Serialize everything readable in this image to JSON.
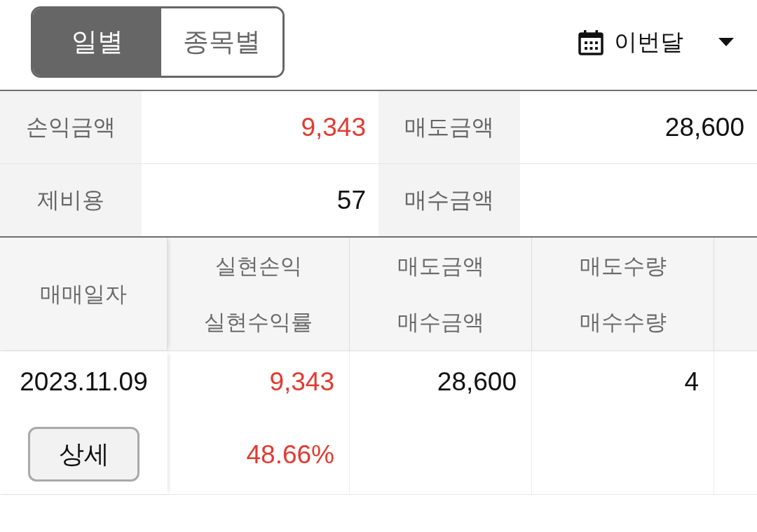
{
  "tabs": [
    {
      "label": "일별",
      "selected": true
    },
    {
      "label": "종목별",
      "selected": false
    }
  ],
  "period_selector": {
    "value": "이번달"
  },
  "summary": {
    "rows": [
      {
        "cells": [
          {
            "label": "손익금액",
            "value": "9,343",
            "color": "#e23b31"
          },
          {
            "label": "매도금액",
            "value": "28,600",
            "color": "#111111"
          }
        ]
      },
      {
        "cells": [
          {
            "label": "제비용",
            "value": "57",
            "color": "#111111"
          },
          {
            "label": "매수금액"
          }
        ]
      }
    ]
  },
  "table": {
    "columns": [
      {
        "lines": [
          "매매일자"
        ]
      },
      {
        "lines": [
          "실현손익",
          "실현수익률"
        ]
      },
      {
        "lines": [
          "매도금액",
          "매수금액"
        ]
      },
      {
        "lines": [
          "매도수량",
          "매수수량"
        ]
      }
    ],
    "rows": [
      {
        "cells": [
          {
            "lines": [
              {
                "text": "2023.11.09",
                "color": "#111111"
              }
            ],
            "button": "상세"
          },
          {
            "lines": [
              {
                "text": "9,343",
                "color": "#e23b31"
              },
              {
                "text": "48.66%",
                "color": "#e23b31"
              }
            ]
          },
          {
            "lines": [
              {
                "text": "28,600",
                "color": "#111111"
              }
            ]
          },
          {
            "lines": [
              {
                "text": "4",
                "color": "#111111"
              }
            ]
          }
        ]
      }
    ]
  }
}
